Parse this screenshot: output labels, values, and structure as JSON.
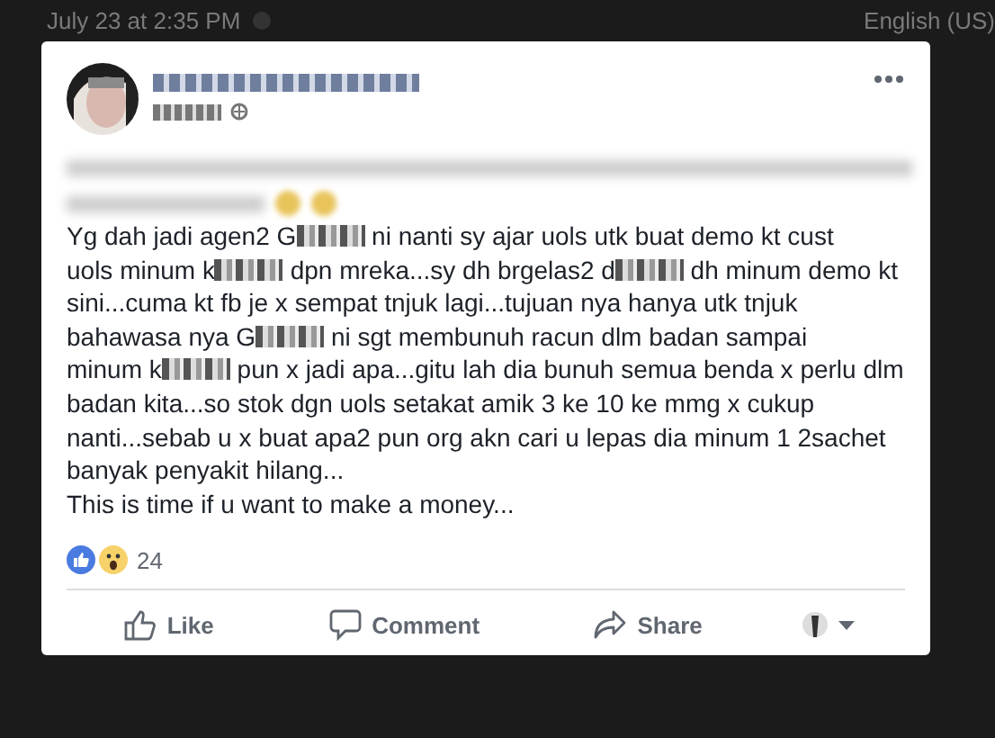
{
  "background": {
    "timestamp": "July 23 at 2:35 PM",
    "language": "English (US)"
  },
  "post": {
    "text_lines": [
      [
        {
          "kind": "text",
          "text": "Yg dah jadi agen2 G"
        },
        {
          "kind": "redacted"
        },
        {
          "kind": "text",
          "text": " ni nanti sy ajar uols utk buat demo kt cust"
        }
      ],
      [
        {
          "kind": "text",
          "text": "uols minum k"
        },
        {
          "kind": "redacted"
        },
        {
          "kind": "text",
          "text": " dpn mreka...sy dh brgelas2 d"
        },
        {
          "kind": "redacted"
        },
        {
          "kind": "text",
          "text": " dh minum demo kt"
        }
      ],
      [
        {
          "kind": "text",
          "text": "sini...cuma kt fb je x sempat tnjuk lagi...tujuan nya hanya utk tnjuk"
        }
      ],
      [
        {
          "kind": "text",
          "text": "bahawasa nya G"
        },
        {
          "kind": "redacted"
        },
        {
          "kind": "text",
          "text": " ni sgt membunuh racun dlm badan sampai"
        }
      ],
      [
        {
          "kind": "text",
          "text": "minum k"
        },
        {
          "kind": "redacted"
        },
        {
          "kind": "text",
          "text": " pun x jadi apa...gitu lah dia bunuh semua benda x perlu dlm"
        }
      ],
      [
        {
          "kind": "text",
          "text": "badan kita...so stok dgn uols setakat amik 3 ke 10 ke mmg x cukup"
        }
      ],
      [
        {
          "kind": "text",
          "text": "nanti...sebab u x buat apa2 pun org akn cari u lepas dia minum 1 2sachet"
        }
      ],
      [
        {
          "kind": "text",
          "text": "banyak penyakit hilang..."
        }
      ],
      [
        {
          "kind": "text",
          "text": "This is time if u want to make a money..."
        }
      ]
    ],
    "reaction_count": "24",
    "actions": [
      {
        "kind": "like",
        "label": "Like"
      },
      {
        "kind": "comment",
        "label": "Comment"
      },
      {
        "kind": "share",
        "label": "Share"
      }
    ]
  }
}
